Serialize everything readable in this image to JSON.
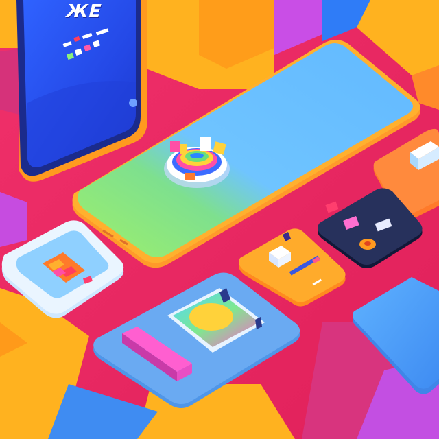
{
  "scene": {
    "background_colors": [
      "#e8245f",
      "#f73a86",
      "#ffb21f",
      "#3f8cff",
      "#c94ee6"
    ],
    "phone_screen_text": "ЖE",
    "objects": [
      {
        "name": "upright-smartphone",
        "color": "#2a56e8"
      },
      {
        "name": "large-tablet-device",
        "color": "#5ab8ff"
      },
      {
        "name": "rainbow-ring-icon",
        "color": "#ffffff"
      },
      {
        "name": "sim-card-tray",
        "color": "#8fd0ff"
      },
      {
        "name": "image-tile",
        "color": "#6aaaf2"
      },
      {
        "name": "orange-card",
        "color": "#ffab2b"
      },
      {
        "name": "dark-wallet-card",
        "color": "#27315c"
      },
      {
        "name": "orange-panel",
        "color": "#ff8a3d"
      },
      {
        "name": "blue-panel",
        "color": "#55a8f2"
      }
    ]
  }
}
